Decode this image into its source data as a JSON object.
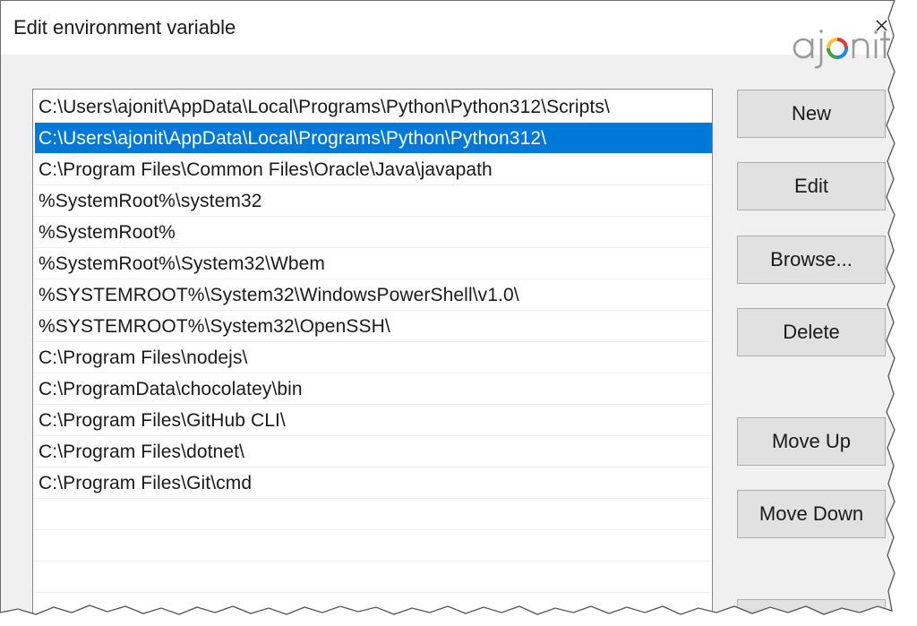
{
  "dialog": {
    "title": "Edit environment variable",
    "close_glyph": "×"
  },
  "logo": {
    "text": "ajonit",
    "colors": [
      "#e53935",
      "#fbc02d",
      "#43a047",
      "#1e88e5"
    ]
  },
  "list": {
    "items": [
      {
        "text": "C:\\Users\\ajonit\\AppData\\Local\\Programs\\Python\\Python312\\Scripts\\",
        "selected": false
      },
      {
        "text": "C:\\Users\\ajonit\\AppData\\Local\\Programs\\Python\\Python312\\",
        "selected": true
      },
      {
        "text": "C:\\Program Files\\Common Files\\Oracle\\Java\\javapath",
        "selected": false
      },
      {
        "text": "%SystemRoot%\\system32",
        "selected": false
      },
      {
        "text": "%SystemRoot%",
        "selected": false
      },
      {
        "text": "%SystemRoot%\\System32\\Wbem",
        "selected": false
      },
      {
        "text": "%SYSTEMROOT%\\System32\\WindowsPowerShell\\v1.0\\",
        "selected": false
      },
      {
        "text": "%SYSTEMROOT%\\System32\\OpenSSH\\",
        "selected": false
      },
      {
        "text": "C:\\Program Files\\nodejs\\",
        "selected": false
      },
      {
        "text": "C:\\ProgramData\\chocolatey\\bin",
        "selected": false
      },
      {
        "text": "C:\\Program Files\\GitHub CLI\\",
        "selected": false
      },
      {
        "text": "C:\\Program Files\\dotnet\\",
        "selected": false
      },
      {
        "text": "C:\\Program Files\\Git\\cmd",
        "selected": false
      },
      {
        "text": "",
        "selected": false
      },
      {
        "text": "",
        "selected": false
      },
      {
        "text": "",
        "selected": false
      }
    ]
  },
  "buttons": {
    "new": "New",
    "edit": "Edit",
    "browse": "Browse...",
    "delete": "Delete",
    "move_up": "Move Up",
    "move_down": "Move Down"
  },
  "colors": {
    "selection": "#0078d7",
    "button_face": "#e1e1e1",
    "dialog_bg": "#f0f0f0"
  }
}
